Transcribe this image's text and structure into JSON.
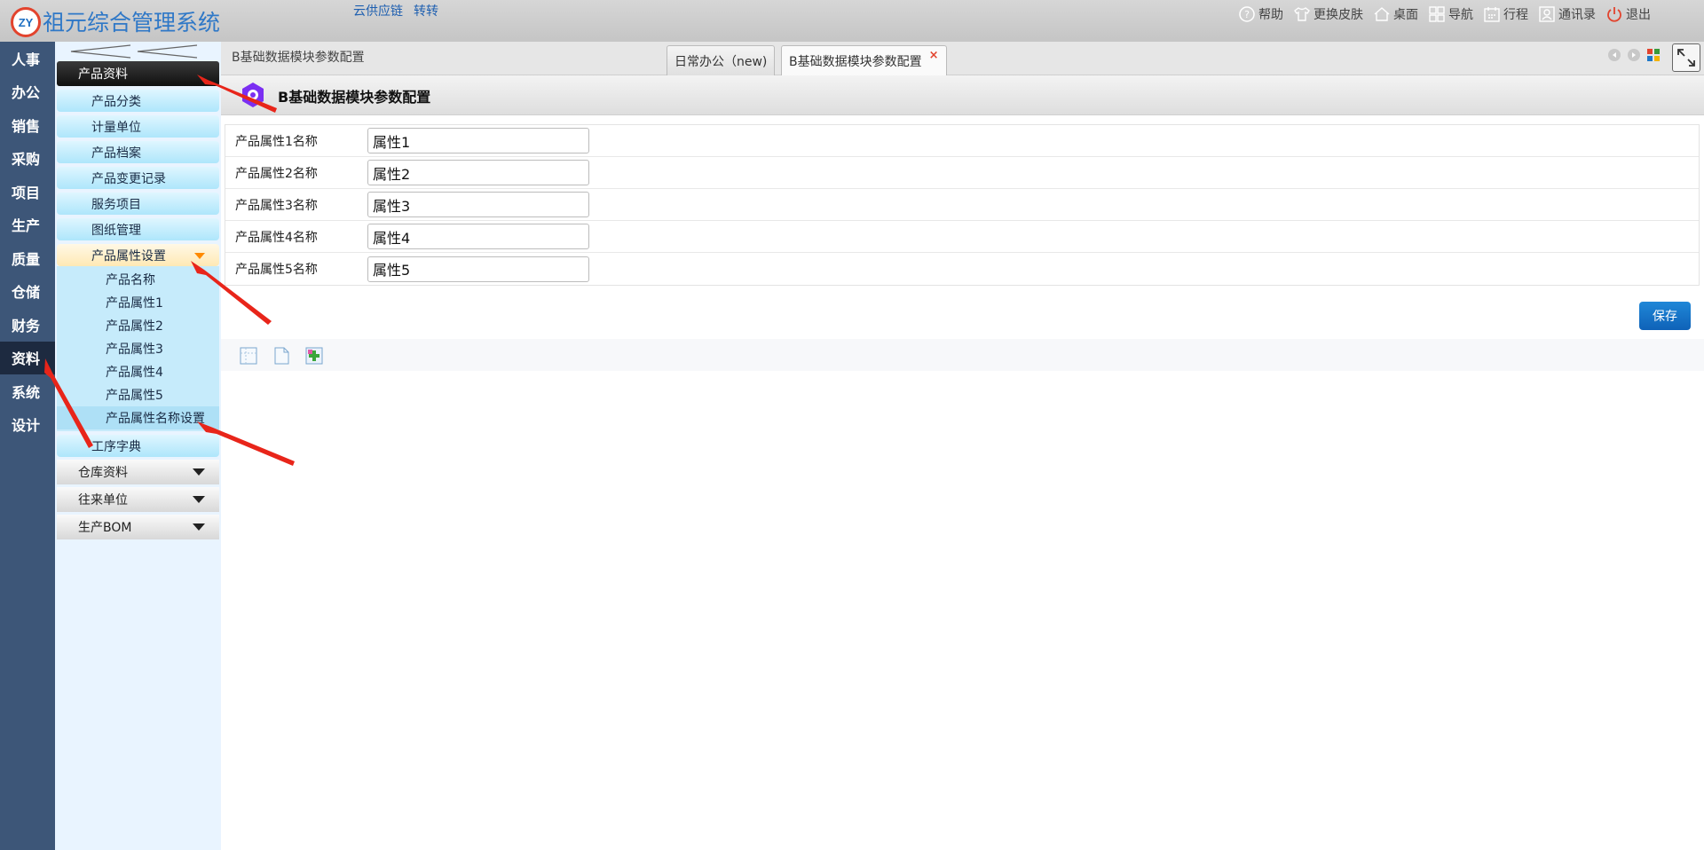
{
  "header": {
    "logo_text": "ZY",
    "app_title": "祖元综合管理系统",
    "links": [
      "云供应链",
      "转转"
    ],
    "menu": [
      {
        "label": "帮助",
        "icon": "help-icon"
      },
      {
        "label": "更换皮肤",
        "icon": "shirt-icon"
      },
      {
        "label": "桌面",
        "icon": "home-icon"
      },
      {
        "label": "导航",
        "icon": "grid-icon"
      },
      {
        "label": "行程",
        "icon": "calendar-icon"
      },
      {
        "label": "通讯录",
        "icon": "contact-icon"
      },
      {
        "label": "退出",
        "icon": "power-icon"
      }
    ]
  },
  "rail": {
    "items": [
      "人事",
      "办公",
      "销售",
      "采购",
      "项目",
      "生产",
      "质量",
      "仓储",
      "财务",
      "资料",
      "系统",
      "设计"
    ],
    "active": "资料"
  },
  "sidebar": {
    "active_category": "产品资料",
    "items": [
      "产品分类",
      "计量单位",
      "产品档案",
      "产品变更记录",
      "服务项目",
      "图纸管理"
    ],
    "open_item": "产品属性设置",
    "open_children": [
      "产品名称",
      "产品属性1",
      "产品属性2",
      "产品属性3",
      "产品属性4",
      "产品属性5",
      "产品属性名称设置"
    ],
    "after_item": "工序字典",
    "closed_categories": [
      "仓库资料",
      "往来单位",
      "生产BOM"
    ]
  },
  "tabs": {
    "breadcrumb": "B基础数据模块参数配置",
    "items": [
      {
        "label": "日常办公（new)"
      },
      {
        "label": "B基础数据模块参数配置",
        "closable": true
      }
    ]
  },
  "page": {
    "title": "B基础数据模块参数配置",
    "fields": [
      {
        "label": "产品属性1名称",
        "value": "属性1"
      },
      {
        "label": "产品属性2名称",
        "value": "属性2"
      },
      {
        "label": "产品属性3名称",
        "value": "属性3"
      },
      {
        "label": "产品属性4名称",
        "value": "属性4"
      },
      {
        "label": "产品属性5名称",
        "value": "属性5"
      }
    ],
    "save_label": "保存"
  },
  "colors": {
    "rail": "#3d5678",
    "accent": "#1f78c8",
    "annotation": "#e8251a"
  }
}
